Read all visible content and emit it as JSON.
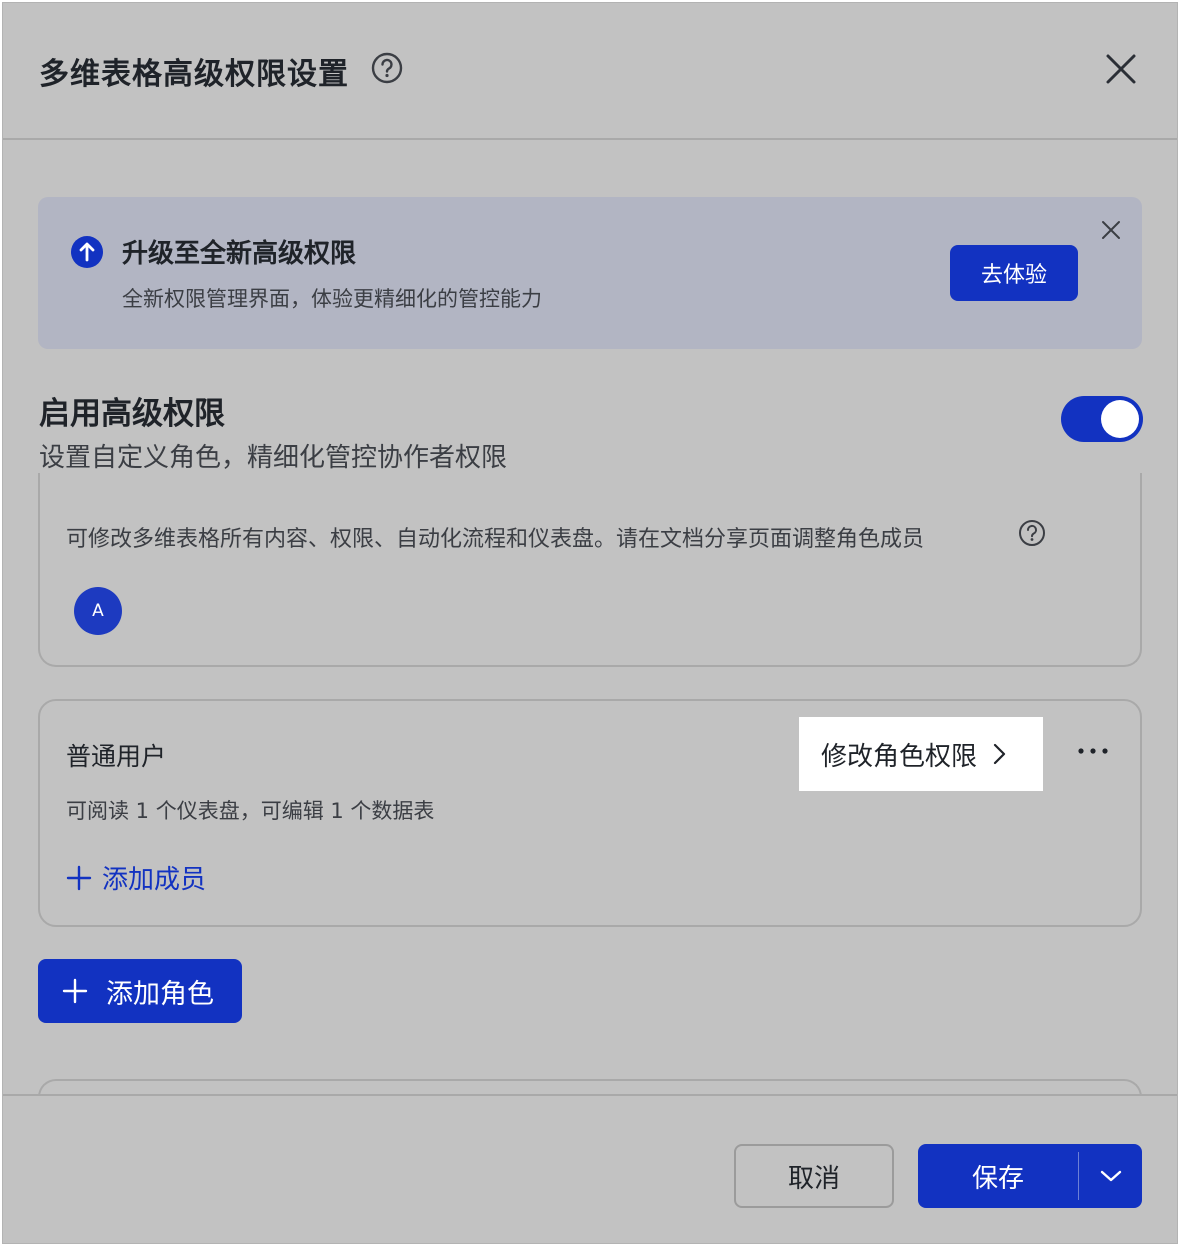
{
  "dialog": {
    "title": "多维表格高级权限设置"
  },
  "banner": {
    "title": "升级至全新高级权限",
    "description": "全新权限管理界面，体验更精细化的管控能力",
    "button_label": "去体验"
  },
  "advanced_permission": {
    "title": "启用高级权限",
    "description": "设置自定义角色，精细化管控协作者权限",
    "enabled": true
  },
  "admin_role": {
    "description": "可修改多维表格所有内容、权限、自动化流程和仪表盘。请在文档分享页面调整角色成员",
    "avatar_letter": "A"
  },
  "user_role": {
    "title": "普通用户",
    "description": "可阅读 1 个仪表盘，可编辑 1 个数据表",
    "edit_permission_label": "修改角色权限",
    "add_member_label": "添加成员"
  },
  "add_role_label": "添加角色",
  "footer": {
    "cancel_label": "取消",
    "save_label": "保存"
  },
  "colors": {
    "accent": "#1232c1",
    "overlay": "#c2c2c2"
  }
}
